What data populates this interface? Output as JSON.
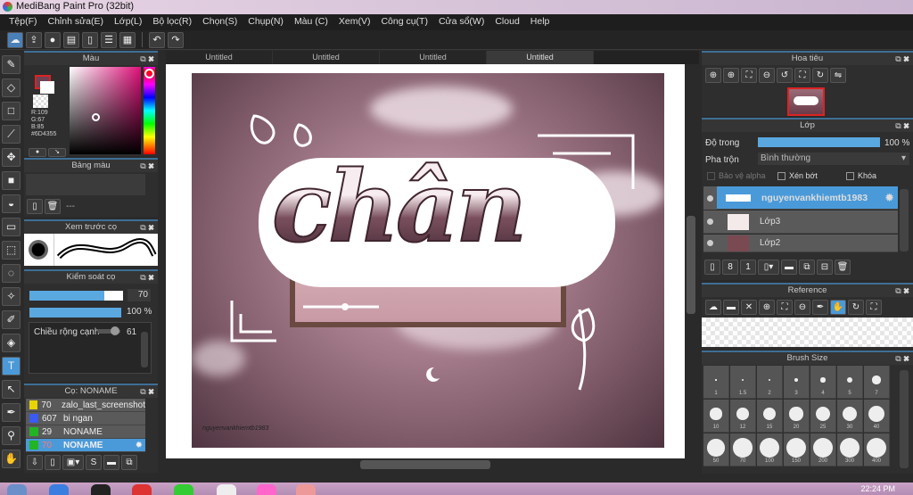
{
  "window": {
    "title": "MediBang Paint Pro (32bit)"
  },
  "menu": [
    "Tệp(F)",
    "Chỉnh sửa(E)",
    "Lớp(L)",
    "Bộ lọc(R)",
    "Chọn(S)",
    "Chụp(N)",
    "Màu (C)",
    "Xem(V)",
    "Công cụ(T)",
    "Cửa sổ(W)",
    "Cloud",
    "Help"
  ],
  "tabs": [
    "Untitled",
    "Untitled",
    "Untitled",
    "Untitled"
  ],
  "color_panel": {
    "title": "Màu",
    "r": "R:109",
    "g": "G:67",
    "b": "B:85",
    "hex": "#6D4355",
    "primary": "#6D4355"
  },
  "palette_panel": {
    "title": "Bảng màu",
    "placeholder": "---"
  },
  "brush_preview": {
    "title": "Xem trước cọ"
  },
  "brush_control": {
    "title": "Kiểm soát cọ",
    "size": "70",
    "opacity": "100 %",
    "edge_label": "Chiều rộng cạnh",
    "edge_value": "61",
    "size_fraction": 0.8,
    "opacity_fraction": 1.0
  },
  "brush_list": {
    "title": "Cọ: NONAME",
    "items": [
      {
        "size": "70",
        "name": "zalo_last_screenshot",
        "color": "#e8d400"
      },
      {
        "size": "607",
        "name": "bi ngan",
        "color": "#3a5af0"
      },
      {
        "size": "29",
        "name": "NONAME",
        "color": "#22b422"
      },
      {
        "size": "70",
        "name": "NONAME",
        "color": "#22b422",
        "selected": true
      }
    ]
  },
  "navigator": {
    "title": "Hoa tiêu"
  },
  "layers": {
    "title": "Lớp",
    "opacity_label": "Độ trong",
    "opacity_value": "100 %",
    "blend_label": "Pha trộn",
    "blend_value": "Bình thường",
    "protect_alpha": "Bảo vệ alpha",
    "clip": "Xén bớt",
    "lock": "Khóa",
    "items": [
      {
        "name": "nguyenvankhiemtb1983",
        "selected": true
      },
      {
        "name": "Lớp3"
      },
      {
        "name": "Lớp2"
      }
    ]
  },
  "reference": {
    "title": "Reference"
  },
  "brush_size": {
    "title": "Brush Size",
    "sizes": [
      "1",
      "1.5",
      "2",
      "3",
      "4",
      "5",
      "7",
      "10",
      "12",
      "15",
      "20",
      "25",
      "30",
      "40",
      "50",
      "70",
      "100",
      "150",
      "200",
      "300",
      "400"
    ]
  },
  "artwork": {
    "word": "chân",
    "signature": "nguyenvankhiemtb1983"
  },
  "taskbar": {
    "clock": "22:24 PM"
  }
}
